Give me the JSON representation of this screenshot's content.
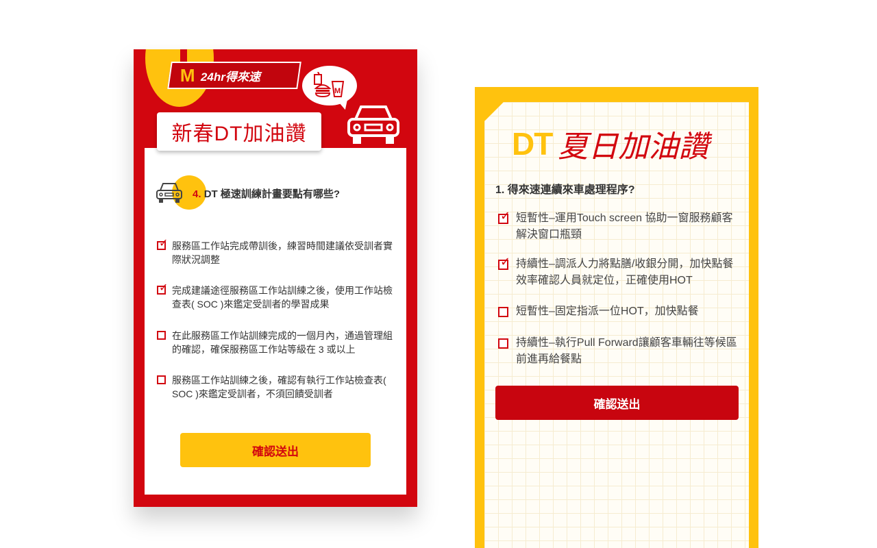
{
  "left_card": {
    "brand_logo": "M",
    "brand_text": "24hr得來速",
    "title": "新春DT加油讚",
    "question_number": "4.",
    "question_text": "DT 極速訓練計畫要點有哪些?",
    "options": [
      {
        "text": "服務區工作站完成帶訓後，練習時間建議依受訓者實際狀況調整",
        "checked": true
      },
      {
        "text": "完成建議途徑服務區工作站訓練之後，使用工作站檢查表( SOC )來鑑定受訓者的學習成果",
        "checked": true
      },
      {
        "text": "在此服務區工作站訓練完成的一個月內，通過管理組的確認，確保服務區工作站等級在 3 或以上",
        "checked": false
      },
      {
        "text": "服務區工作站訓練之後，確認有執行工作站檢查表( SOC )來鑑定受訓者，不須回饋受訓者",
        "checked": false
      }
    ],
    "submit_label": "確認送出",
    "check_mark": "✓"
  },
  "right_card": {
    "title_dt": "DT",
    "title_rest": "夏日加油讚",
    "question_text": "1. 得來速連續來車處理程序?",
    "options": [
      {
        "text": "短暫性–運用Touch screen 協助一窗服務顧客解決窗口瓶頸",
        "checked": true
      },
      {
        "text": "持續性–調派人力將點膳/收銀分開，加快點餐效率確認人員就定位，正確使用HOT",
        "checked": true
      },
      {
        "text": "短暫性–固定指派一位HOT，加快點餐",
        "checked": false
      },
      {
        "text": "持續性–執行Pull Forward讓顧客車輛往等候區前進再給餐點",
        "checked": false
      }
    ],
    "submit_label": "確認送出",
    "check_mark": "✓"
  },
  "colors": {
    "red": "#d2060f",
    "yellow": "#ffc20e"
  },
  "icons": [
    "mcdonalds-logo-icon",
    "food-bubble-icon",
    "car-icon",
    "checkbox-icon"
  ]
}
